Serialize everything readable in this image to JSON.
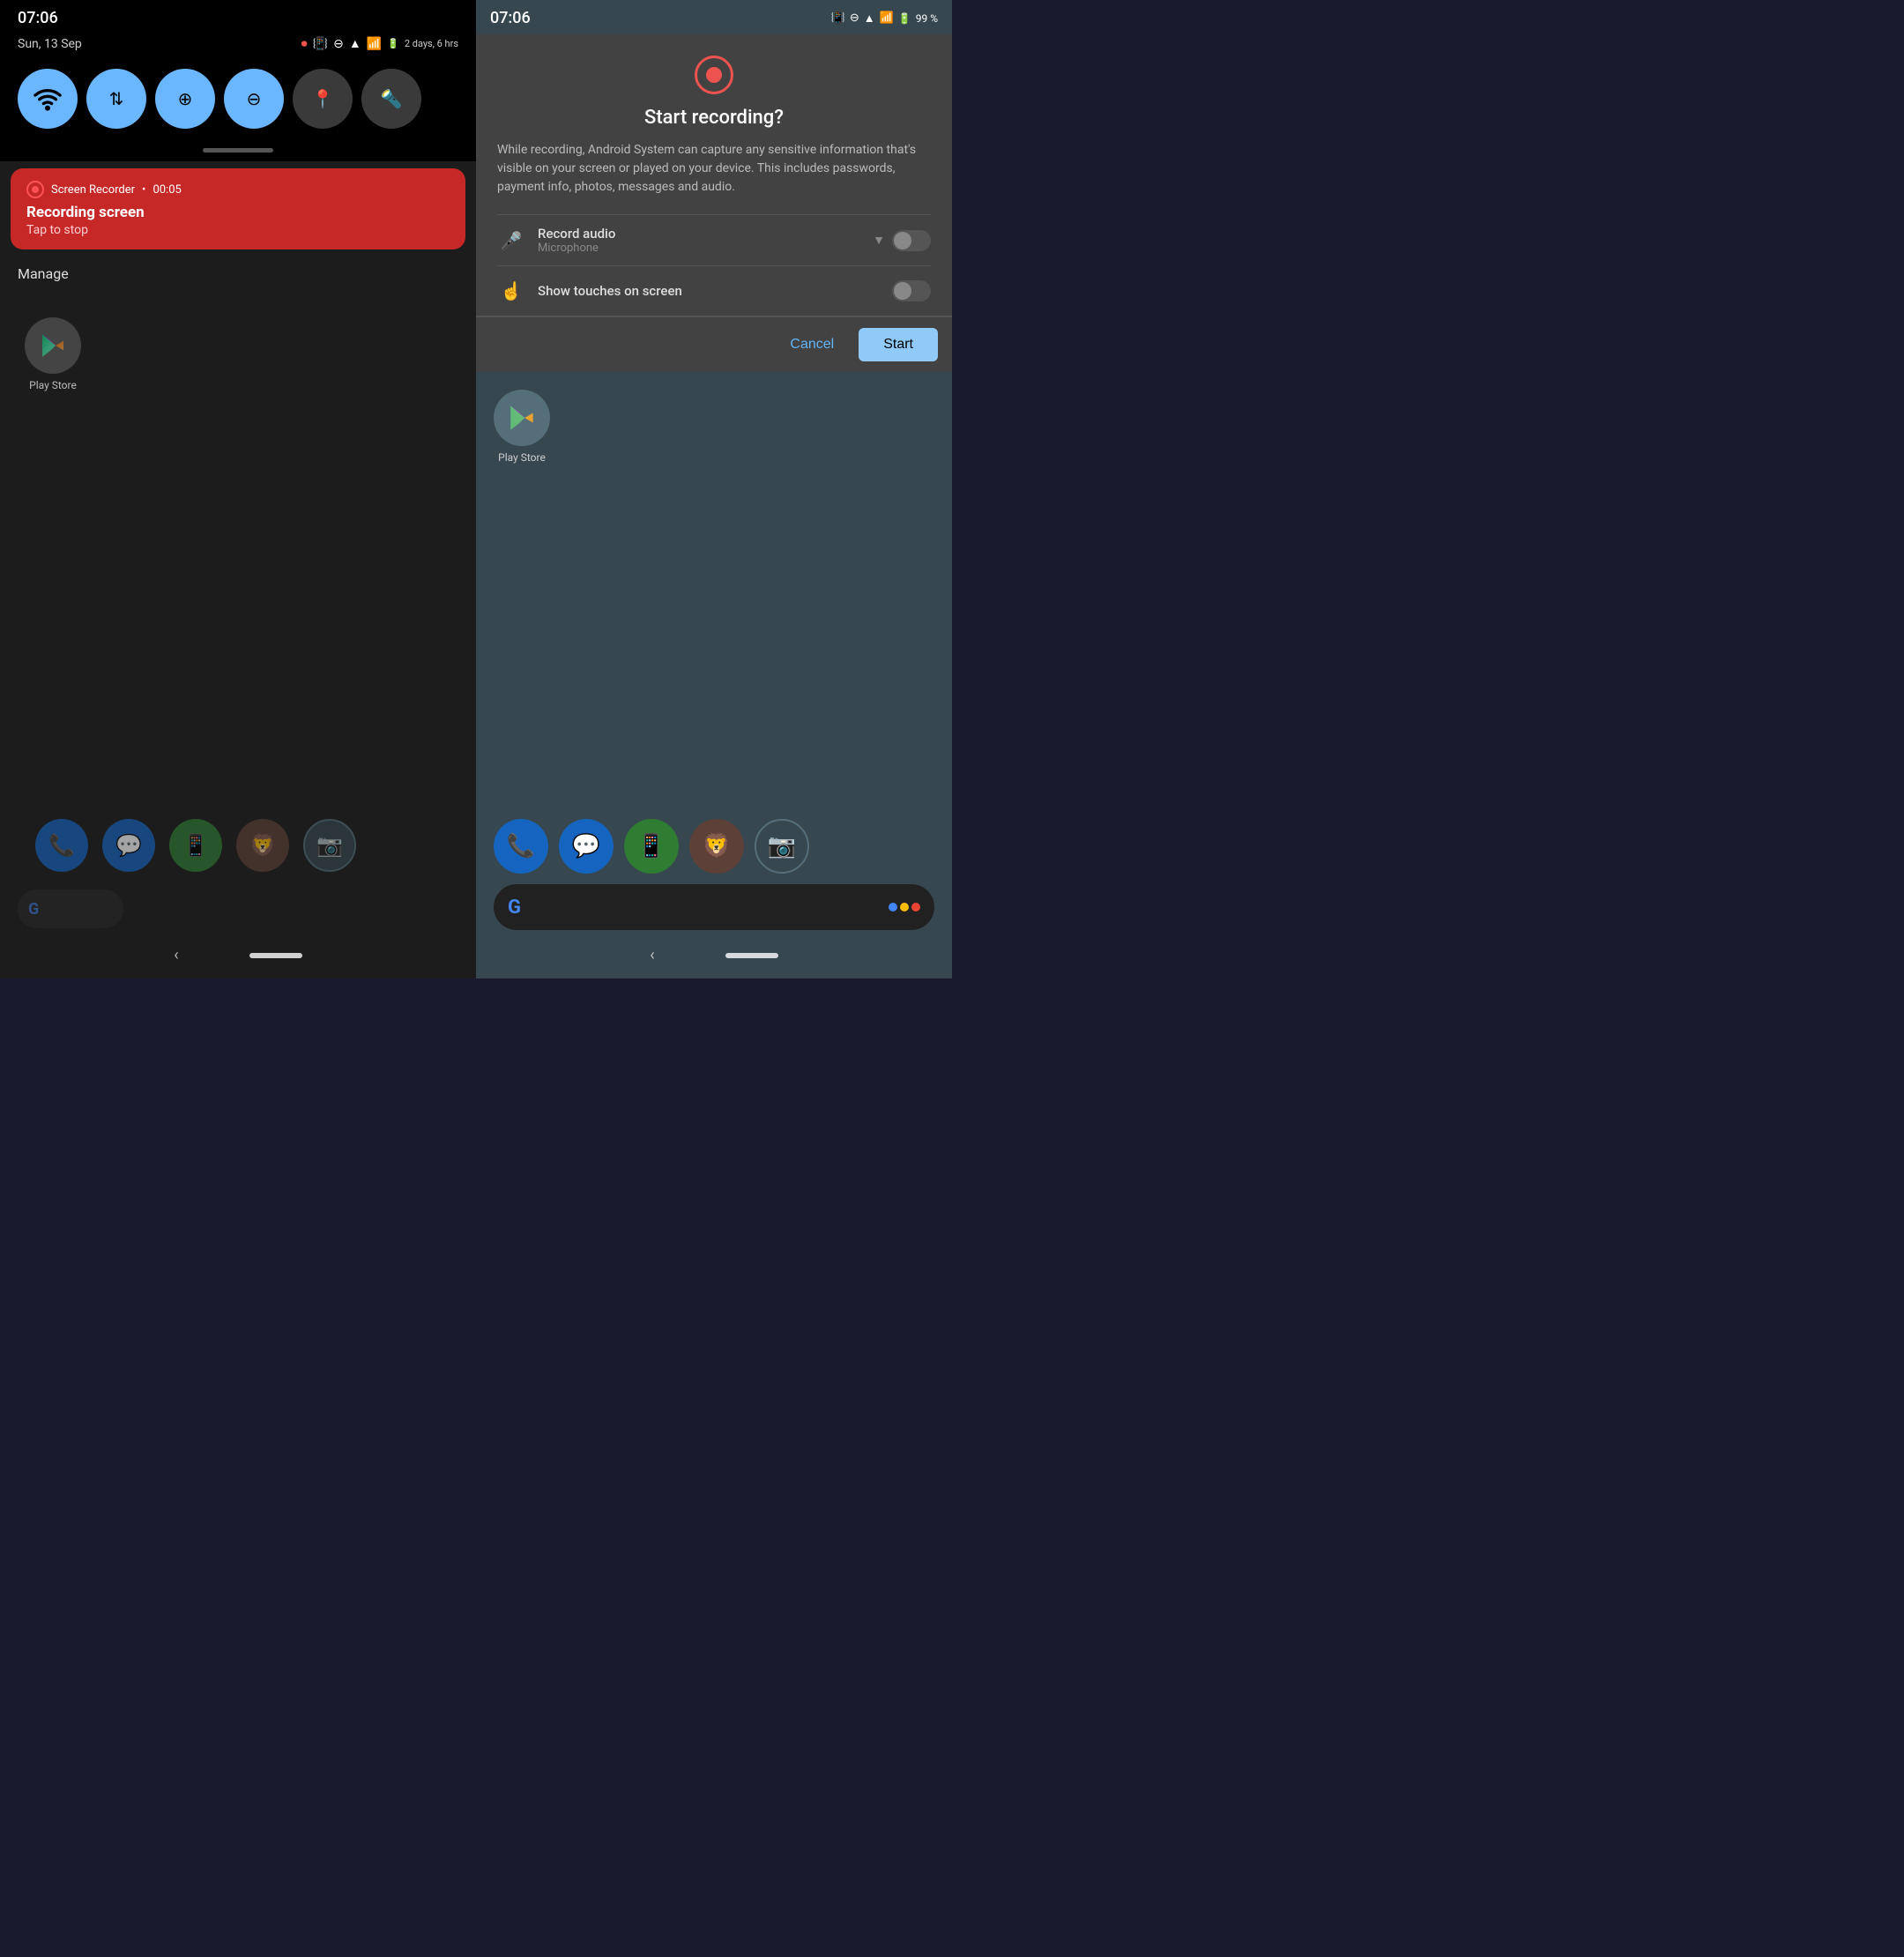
{
  "left": {
    "status_time": "07:06",
    "date": "Sun, 13 Sep",
    "battery_text": "2 days, 6 hrs",
    "quick_tiles": [
      {
        "id": "wifi",
        "icon": "📶",
        "active": true
      },
      {
        "id": "data",
        "icon": "↕",
        "active": true
      },
      {
        "id": "battery_saver",
        "icon": "🔋",
        "active": true
      },
      {
        "id": "dnd",
        "icon": "⊖",
        "active": true
      },
      {
        "id": "location",
        "icon": "📍",
        "active": false
      },
      {
        "id": "flashlight",
        "icon": "🔦",
        "active": false
      }
    ],
    "recording_notification": {
      "app_name": "Screen Recorder",
      "duration": "00:05",
      "title": "Recording screen",
      "subtitle": "Tap to stop"
    },
    "manage_label": "Manage",
    "play_store_label": "Play Store",
    "dock_apps": [
      "Phone",
      "Messages",
      "WhatsApp",
      "Brave",
      "Camera"
    ]
  },
  "right": {
    "status_time": "07:06",
    "battery_percent": "99 %",
    "dialog": {
      "title": "Start recording?",
      "body": "While recording, Android System can capture any sensitive information that's visible on your screen or played on your device. This includes passwords, payment info, photos, messages and audio.",
      "option1_title": "Record audio",
      "option1_subtitle": "Microphone",
      "option2_title": "Show touches on screen",
      "cancel_label": "Cancel",
      "start_label": "Start"
    },
    "play_store_label": "Play Store",
    "dock_apps": [
      "Phone",
      "Messages",
      "WhatsApp",
      "Brave",
      "Camera"
    ]
  }
}
